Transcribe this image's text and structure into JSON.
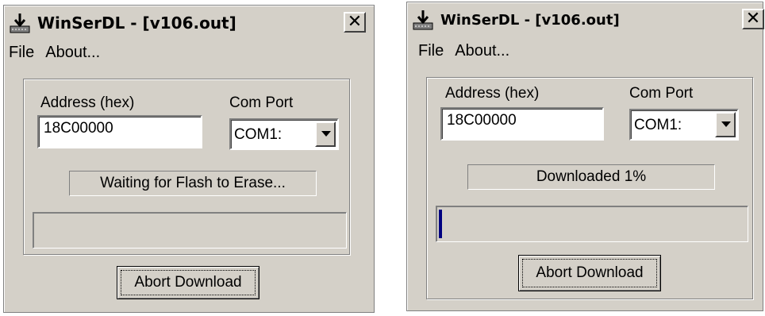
{
  "windows": [
    {
      "title": "WinSerDL - [v106.out]",
      "close_glyph": "✕",
      "menu": [
        "File",
        "About..."
      ],
      "address_label": "Address (hex)",
      "address_value": "18C00000",
      "port_label": "Com Port",
      "port_value": "COM1:",
      "status_text": "Waiting for Flash to Erase...",
      "progress_fraction": 0.0,
      "button_label": "Abort Download"
    },
    {
      "title": "WinSerDL - [v106.out]",
      "close_glyph": "✕",
      "menu": [
        "File",
        "About..."
      ],
      "address_label": "Address (hex)",
      "address_value": "18C00000",
      "port_label": "Com Port",
      "port_value": "COM1:",
      "status_text": "Downloaded 1%",
      "progress_fraction": 0.01,
      "button_label": "Abort Download"
    }
  ],
  "icons": {
    "app": "download-arrow-icon",
    "close": "close-icon",
    "dropdown": "chevron-down-icon"
  },
  "colors": {
    "window_bg": "#d4d0c8",
    "progress_fill": "#000080"
  }
}
